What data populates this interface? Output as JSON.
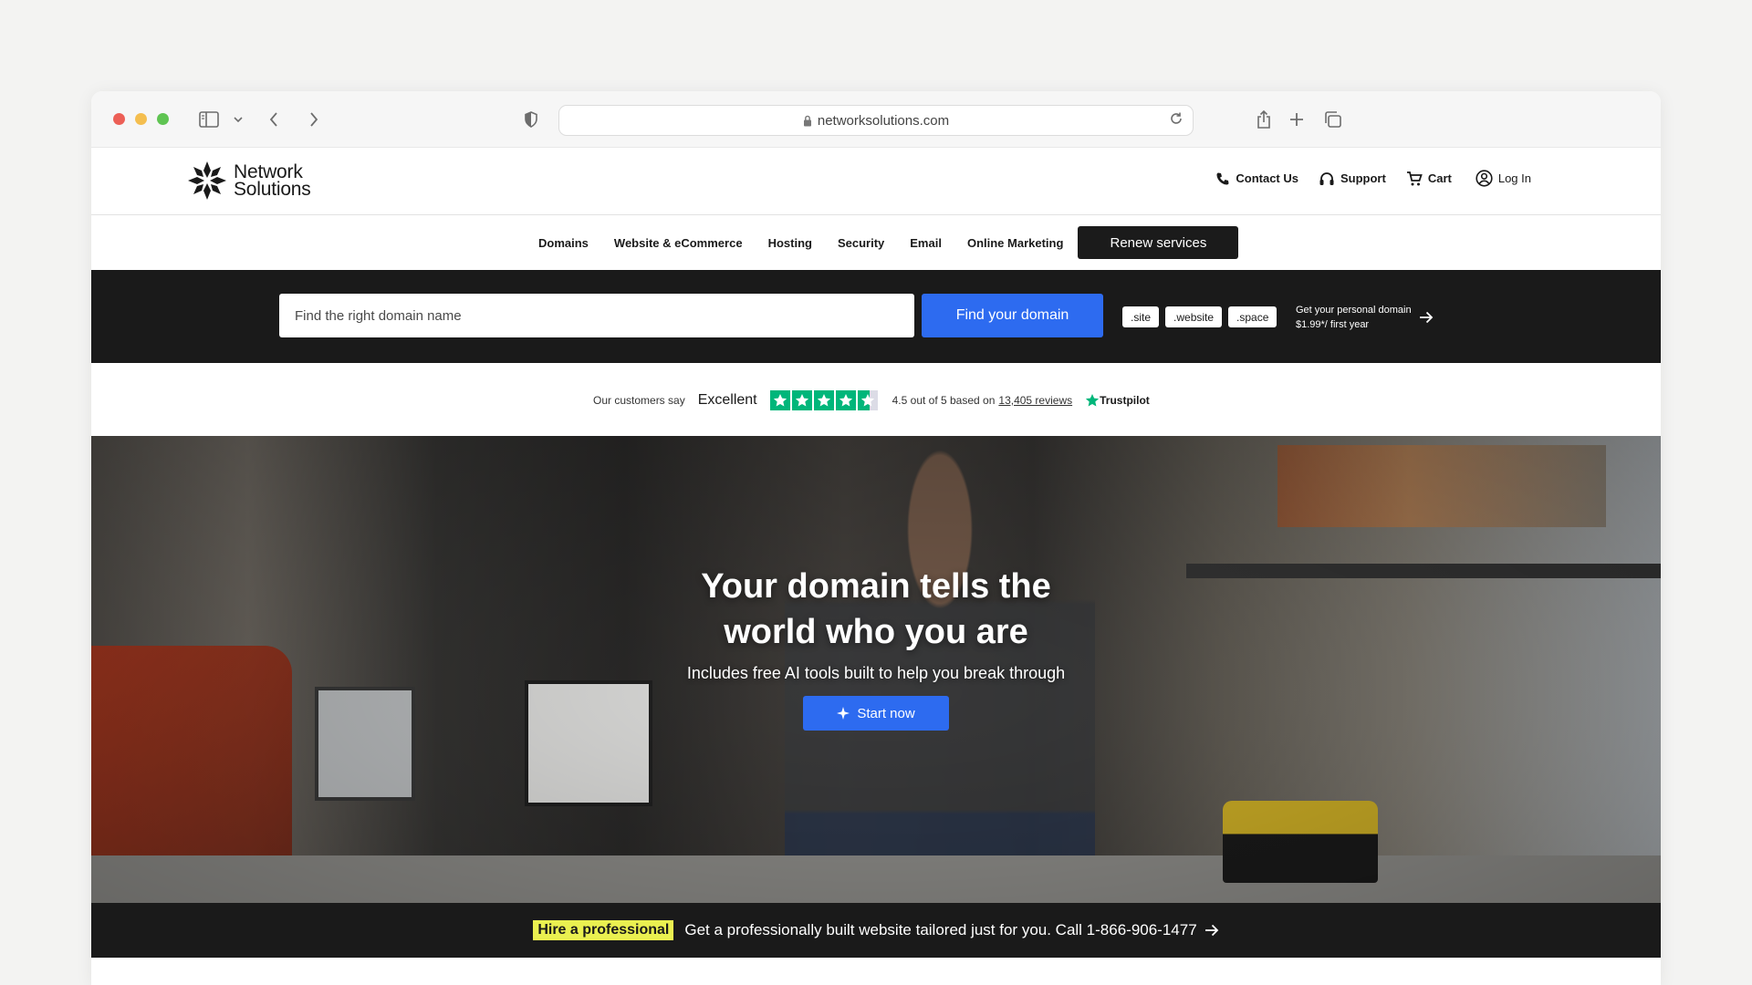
{
  "browser": {
    "url": "networksolutions.com"
  },
  "brand": {
    "name_line1": "Network",
    "name_line2": "Solutions",
    "accent": "#2d6bf0",
    "dark": "#1a1a1a",
    "highlight": "#eaf050",
    "trustpilot_green": "#00b67a"
  },
  "header_links": [
    {
      "label": "Contact Us",
      "icon": "phone-icon"
    },
    {
      "label": "Support",
      "icon": "headset-icon"
    },
    {
      "label": "Cart",
      "icon": "cart-icon"
    },
    {
      "label": "Log In",
      "icon": "user-icon"
    }
  ],
  "nav": {
    "items": [
      "Domains",
      "Website & eCommerce",
      "Hosting",
      "Security",
      "Email",
      "Online Marketing"
    ],
    "cta": "Renew services"
  },
  "search": {
    "placeholder": "Find the right domain name",
    "button": "Find your domain",
    "tlds": [
      ".site",
      ".website",
      ".space"
    ],
    "promo_line1": "Get your personal domain",
    "promo_line2": "$1.99*/ first year"
  },
  "reviews": {
    "prefix": "Our customers say",
    "rating_word": "Excellent",
    "stars": 4.5,
    "score_text": "4.5 out of 5 based on",
    "reviews_link": "13,405 reviews",
    "brand": "Trustpilot"
  },
  "hero": {
    "title_line1": "Your domain tells the",
    "title_line2": "world who you are",
    "subtitle": "Includes free AI tools built to help you break through",
    "cta": "Start now"
  },
  "banner": {
    "badge": "Hire a professional",
    "text": "Get a professionally built website tailored just for you. Call 1-866-906-1477"
  }
}
